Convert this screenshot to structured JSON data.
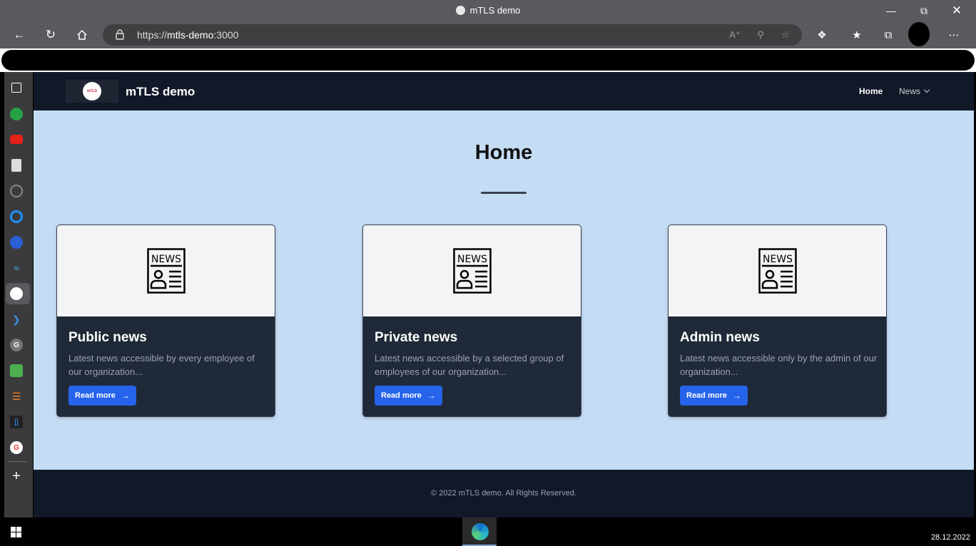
{
  "browser": {
    "window_title": "mTLS demo",
    "url_prefix": "https://",
    "url_host": "mtls-demo",
    "url_port": ":3000"
  },
  "site": {
    "brand": "mTLS demo",
    "logo_text": "mTLS",
    "nav": {
      "home": "Home",
      "news": "News"
    }
  },
  "main": {
    "title": "Home",
    "cards": [
      {
        "title": "Public news",
        "description": "Latest news accessible by every employee of our organization...",
        "button": "Read more"
      },
      {
        "title": "Private news",
        "description": "Latest news accessible by a selected group of employees of our organization...",
        "button": "Read more"
      },
      {
        "title": "Admin news",
        "description": "Latest news accessible only by the admin of our organization...",
        "button": "Read more"
      }
    ]
  },
  "footer": {
    "text": "© 2022 mTLS demo. All Rights Reserved."
  },
  "taskbar": {
    "date": "28.12.2022"
  },
  "colors": {
    "nav_bg": "#111827",
    "page_bg": "#c5dcf5",
    "card_bg": "#1f2937",
    "button": "#2563eb"
  }
}
